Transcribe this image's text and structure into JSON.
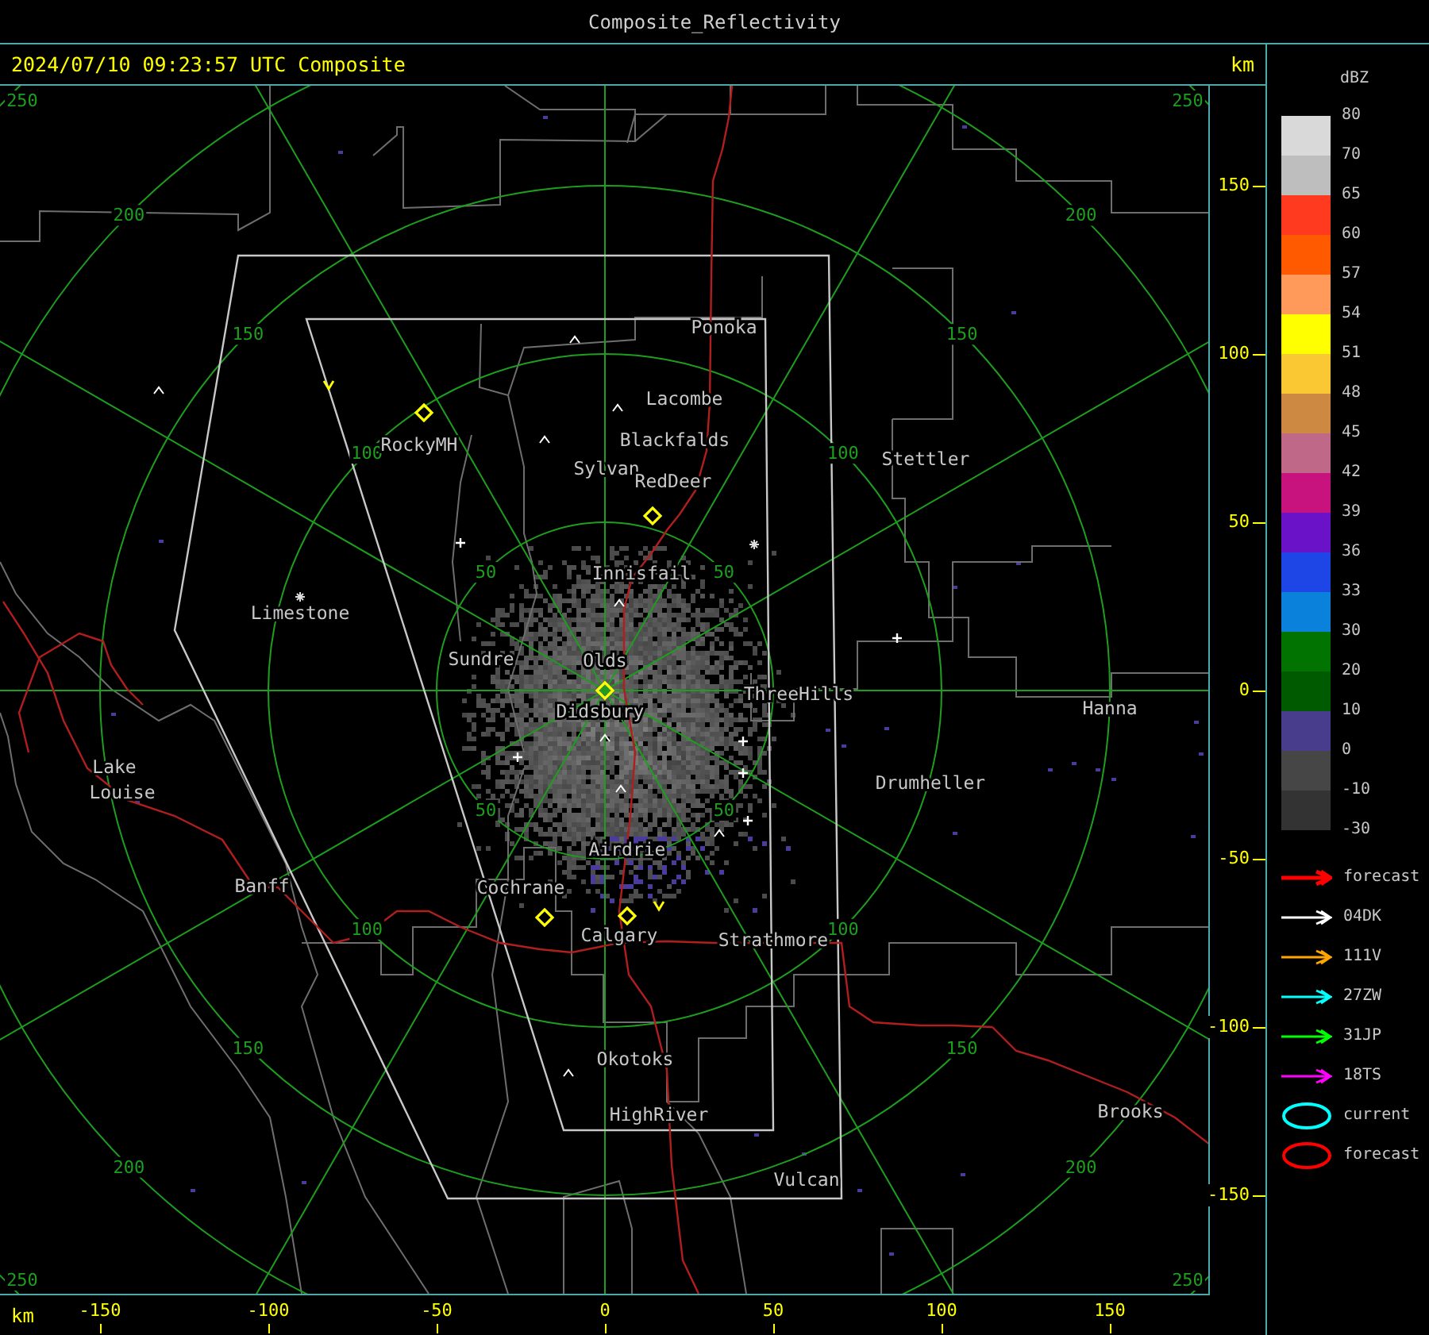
{
  "window": {
    "title": "Composite_Reflectivity"
  },
  "header": {
    "timestamp": "2024/07/10 09:23:57 UTC Composite",
    "units": "km"
  },
  "map": {
    "rings": [
      {
        "labels": [
          "50",
          "50",
          "50",
          "50"
        ]
      },
      {
        "labels": [
          "100",
          "100",
          "100",
          "100"
        ]
      },
      {
        "labels": [
          "150",
          "150",
          "150",
          "150"
        ]
      },
      {
        "labels": [
          "200",
          "200",
          "200",
          "200"
        ]
      },
      {
        "labels": [
          "250",
          "250",
          "250",
          "250"
        ]
      }
    ],
    "places": [
      "Ponoka",
      "Lacombe",
      "Blackfalds",
      "Sylvan",
      "RedDeer",
      "Stettler",
      "RockyMH",
      "Innisfail",
      "Limestone",
      "Sundre",
      "Olds",
      "Didsbury",
      "ThreeHills",
      "Hanna",
      "Lake",
      "Louise",
      "Drumheller",
      "Airdrie",
      "Banff",
      "Cochrane",
      "Calgary",
      "Strathmore",
      "Okotoks",
      "HighRiver",
      "Brooks",
      "Vulcan"
    ]
  },
  "y_axis": {
    "ticks": [
      "150",
      "100",
      "50",
      "0",
      "-50",
      "-100",
      "-150"
    ]
  },
  "x_axis": {
    "units": "km",
    "ticks": [
      "-150",
      "-100",
      "-50",
      "0",
      "50",
      "100",
      "150"
    ]
  },
  "legend": {
    "title": "dBZ",
    "scale_labels": [
      "80",
      "70",
      "65",
      "60",
      "57",
      "54",
      "51",
      "48",
      "45",
      "42",
      "39",
      "36",
      "33",
      "30",
      "20",
      "10",
      "0",
      "-10",
      "-30"
    ],
    "bands": [
      {
        "color": "#d9d9d9"
      },
      {
        "color": "#bebebe"
      },
      {
        "color": "#ff3a1e"
      },
      {
        "color": "#ff5a00"
      },
      {
        "color": "#ff9a5a"
      },
      {
        "color": "#ffff00"
      },
      {
        "color": "#fac832"
      },
      {
        "color": "#cd8841"
      },
      {
        "color": "#bf6888"
      },
      {
        "color": "#c8137f"
      },
      {
        "color": "#6a12c8"
      },
      {
        "color": "#1e46e6"
      },
      {
        "color": "#0a82dc"
      },
      {
        "color": "#007300"
      },
      {
        "color": "#005a00"
      },
      {
        "color": "#483c8c"
      },
      {
        "color": "#464646"
      },
      {
        "color": "#333333"
      }
    ],
    "tracks": [
      {
        "label": "forecast",
        "color": "#ff0000"
      },
      {
        "label": "04DK",
        "color": "#ffffff"
      },
      {
        "label": "111V",
        "color": "#ffa500"
      },
      {
        "label": "27ZW",
        "color": "#00ffff"
      },
      {
        "label": "31JP",
        "color": "#00ff00"
      },
      {
        "label": "18TS",
        "color": "#ff00ff"
      }
    ],
    "cells": [
      {
        "label": "current",
        "color": "#00ffff"
      },
      {
        "label": "forecast",
        "color": "#ff0000"
      }
    ]
  }
}
